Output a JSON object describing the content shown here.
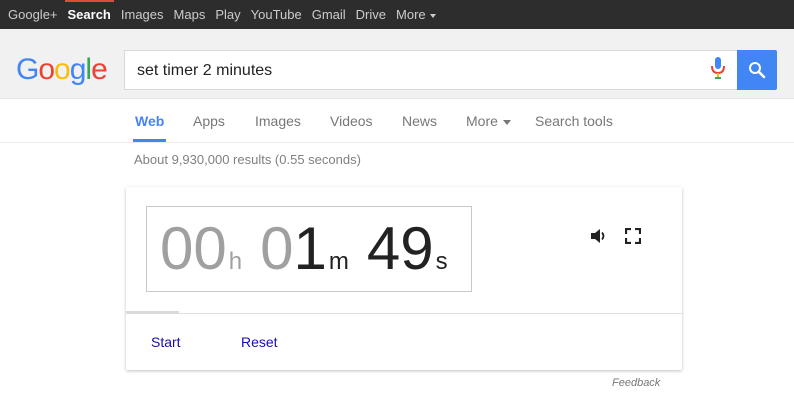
{
  "topnav": {
    "items": [
      "Google+",
      "Search",
      "Images",
      "Maps",
      "Play",
      "YouTube",
      "Gmail",
      "Drive",
      "More"
    ],
    "active_index": 1
  },
  "logo": {
    "letters": [
      "G",
      "o",
      "o",
      "g",
      "l",
      "e"
    ],
    "colors": [
      "#4285f4",
      "#ea4335",
      "#fbbc05",
      "#4285f4",
      "#34a853",
      "#ea4335"
    ]
  },
  "search": {
    "query": "set timer 2 minutes",
    "button_color": "#4285f4"
  },
  "tabs": {
    "items": [
      "Web",
      "Apps",
      "Images",
      "Videos",
      "News",
      "More",
      "Search tools"
    ],
    "active": "Web"
  },
  "results": {
    "stats": "About 9,930,000 results (0.55 seconds)"
  },
  "timer": {
    "hours": "00",
    "hours_unit": "h",
    "minutes": "01",
    "minutes_unit": "m",
    "seconds": "49",
    "seconds_unit": "s",
    "elapsed_fraction": 0.095,
    "start_label": "Start",
    "reset_label": "Reset"
  },
  "icons": {
    "sound": "speaker-icon",
    "fullscreen": "fullscreen-icon"
  },
  "footer": {
    "feedback": "Feedback"
  }
}
